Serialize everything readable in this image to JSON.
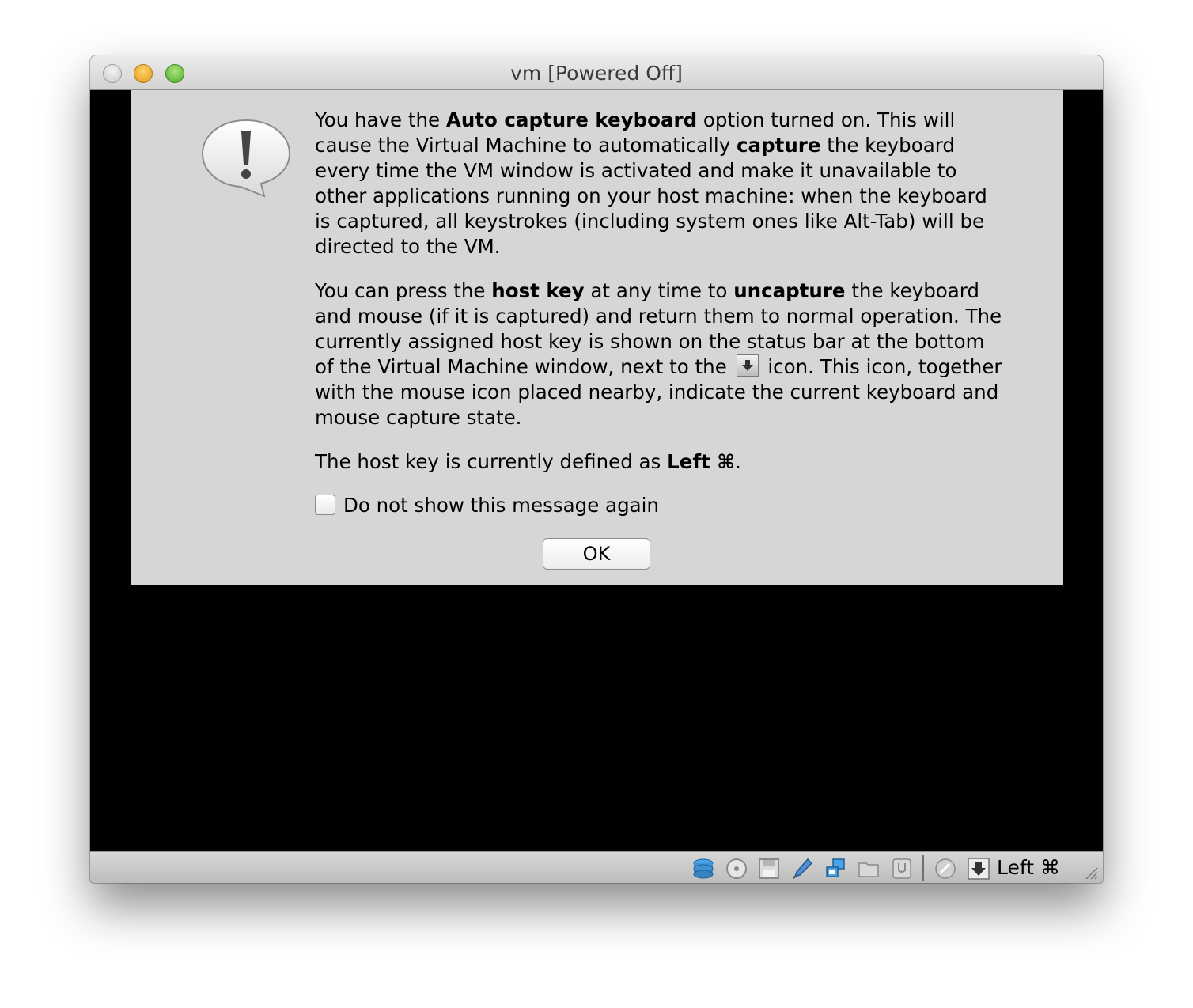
{
  "window": {
    "title": "vm [Powered Off]"
  },
  "dialog": {
    "p1": {
      "t1": "You have the ",
      "b1": "Auto capture keyboard",
      "t2": " option turned on. This will cause the Virtual Machine to automatically ",
      "b2": "capture",
      "t3": " the keyboard every time the VM window is activated and make it unavailable to other applications running on your host machine: when the keyboard is captured, all keystrokes (including system ones like Alt-Tab) will be directed to the VM."
    },
    "p2": {
      "t1": "You can press the ",
      "b1": "host key",
      "t2": " at any time to ",
      "b2": "uncapture",
      "t3": " the keyboard and mouse (if it is captured) and return them to normal operation. The currently assigned host key is shown on the status bar at the bottom of the Virtual Machine window, next to the",
      "t4": "icon. This icon, together with the mouse icon placed nearby, indicate the current keyboard and mouse capture state."
    },
    "p3": {
      "t1": "The host key is currently defined as ",
      "b1": "Left ⌘",
      "t2": "."
    },
    "checkbox_label": "Do not show this message again",
    "ok_label": "OK",
    "icon": "exclamation-bubble-icon"
  },
  "statusbar": {
    "host_key_label": "Left ⌘",
    "icons": [
      "hard-disk-icon",
      "optical-disk-icon",
      "floppy-icon",
      "usb-pen-icon",
      "network-icon",
      "shared-folder-icon",
      "usb-device-icon",
      "mouse-capture-icon",
      "keyboard-capture-icon"
    ]
  }
}
